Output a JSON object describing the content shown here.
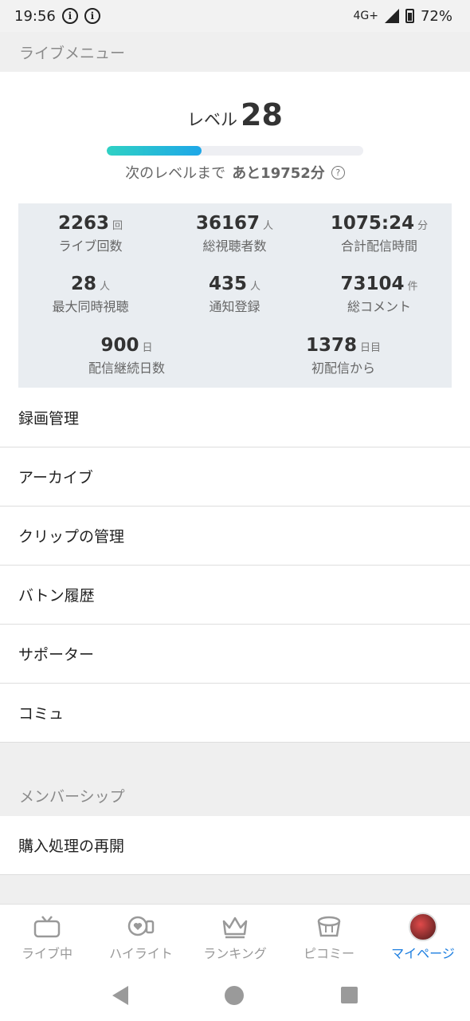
{
  "status_bar": {
    "time": "19:56",
    "network": "4G+",
    "battery": "72%"
  },
  "live_menu_header": "ライブメニュー",
  "level": {
    "label": "レベル",
    "value": "28",
    "progress_fraction": 0.37,
    "next_label": "次のレベルまで",
    "next_rest": "あと19752分"
  },
  "stats": [
    {
      "value": "2263",
      "unit": "回",
      "caption": "ライブ回数"
    },
    {
      "value": "36167",
      "unit": "人",
      "caption": "総視聴者数"
    },
    {
      "value": "1075:24",
      "unit": "分",
      "caption": "合計配信時間"
    },
    {
      "value": "28",
      "unit": "人",
      "caption": "最大同時視聴"
    },
    {
      "value": "435",
      "unit": "人",
      "caption": "通知登録"
    },
    {
      "value": "73104",
      "unit": "件",
      "caption": "総コメント"
    },
    {
      "value": "900",
      "unit": "日",
      "caption": "配信継続日数"
    },
    {
      "value": "1378",
      "unit": "日目",
      "caption": "初配信から"
    }
  ],
  "menu_items": [
    "録画管理",
    "アーカイブ",
    "クリップの管理",
    "バトン履歴",
    "サポーター",
    "コミュ"
  ],
  "membership_header": "メンバーシップ",
  "membership_items": [
    "購入処理の再開"
  ],
  "bottom_nav": [
    {
      "label": "ライブ中",
      "icon": "tv-icon"
    },
    {
      "label": "ハイライト",
      "icon": "highlight-icon"
    },
    {
      "label": "ランキング",
      "icon": "crown-icon"
    },
    {
      "label": "ピコミー",
      "icon": "picomy-icon"
    },
    {
      "label": "マイページ",
      "icon": "avatar"
    }
  ],
  "colors": {
    "accent": "#1e7fe0",
    "progress_start": "#2fd1c4",
    "progress_end": "#1ea7e8",
    "stats_bg": "#e9edf1"
  }
}
